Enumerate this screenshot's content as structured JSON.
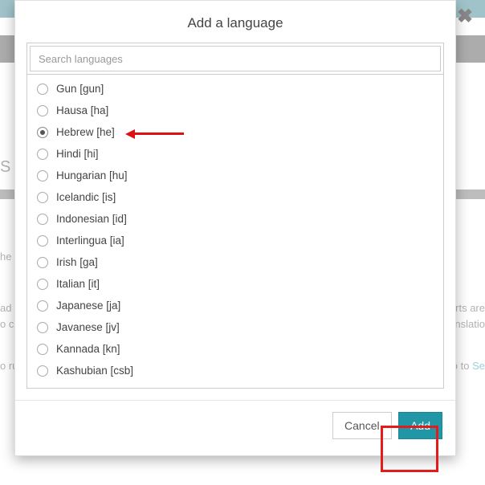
{
  "modal": {
    "title": "Add a language",
    "search_placeholder": "Search languages",
    "cancel": "Cancel",
    "add": "Add"
  },
  "languages": [
    {
      "label": "Gun [gun]",
      "selected": false
    },
    {
      "label": "Hausa [ha]",
      "selected": false
    },
    {
      "label": "Hebrew [he]",
      "selected": true
    },
    {
      "label": "Hindi [hi]",
      "selected": false
    },
    {
      "label": "Hungarian [hu]",
      "selected": false
    },
    {
      "label": "Icelandic [is]",
      "selected": false
    },
    {
      "label": "Indonesian [id]",
      "selected": false
    },
    {
      "label": "Interlingua [ia]",
      "selected": false
    },
    {
      "label": "Irish [ga]",
      "selected": false
    },
    {
      "label": "Italian [it]",
      "selected": false
    },
    {
      "label": "Japanese [ja]",
      "selected": false
    },
    {
      "label": "Javanese [jv]",
      "selected": false
    },
    {
      "label": "Kannada [kn]",
      "selected": false
    },
    {
      "label": "Kashubian [csb]",
      "selected": false
    }
  ],
  "bgtext": {
    "s": "S",
    "the": "he",
    "ad": "ad",
    "oc": "o c",
    "run": "o ru",
    "ports": "ports are",
    "trans": "Translatio",
    "goto": "e go to",
    "se": "Se"
  }
}
